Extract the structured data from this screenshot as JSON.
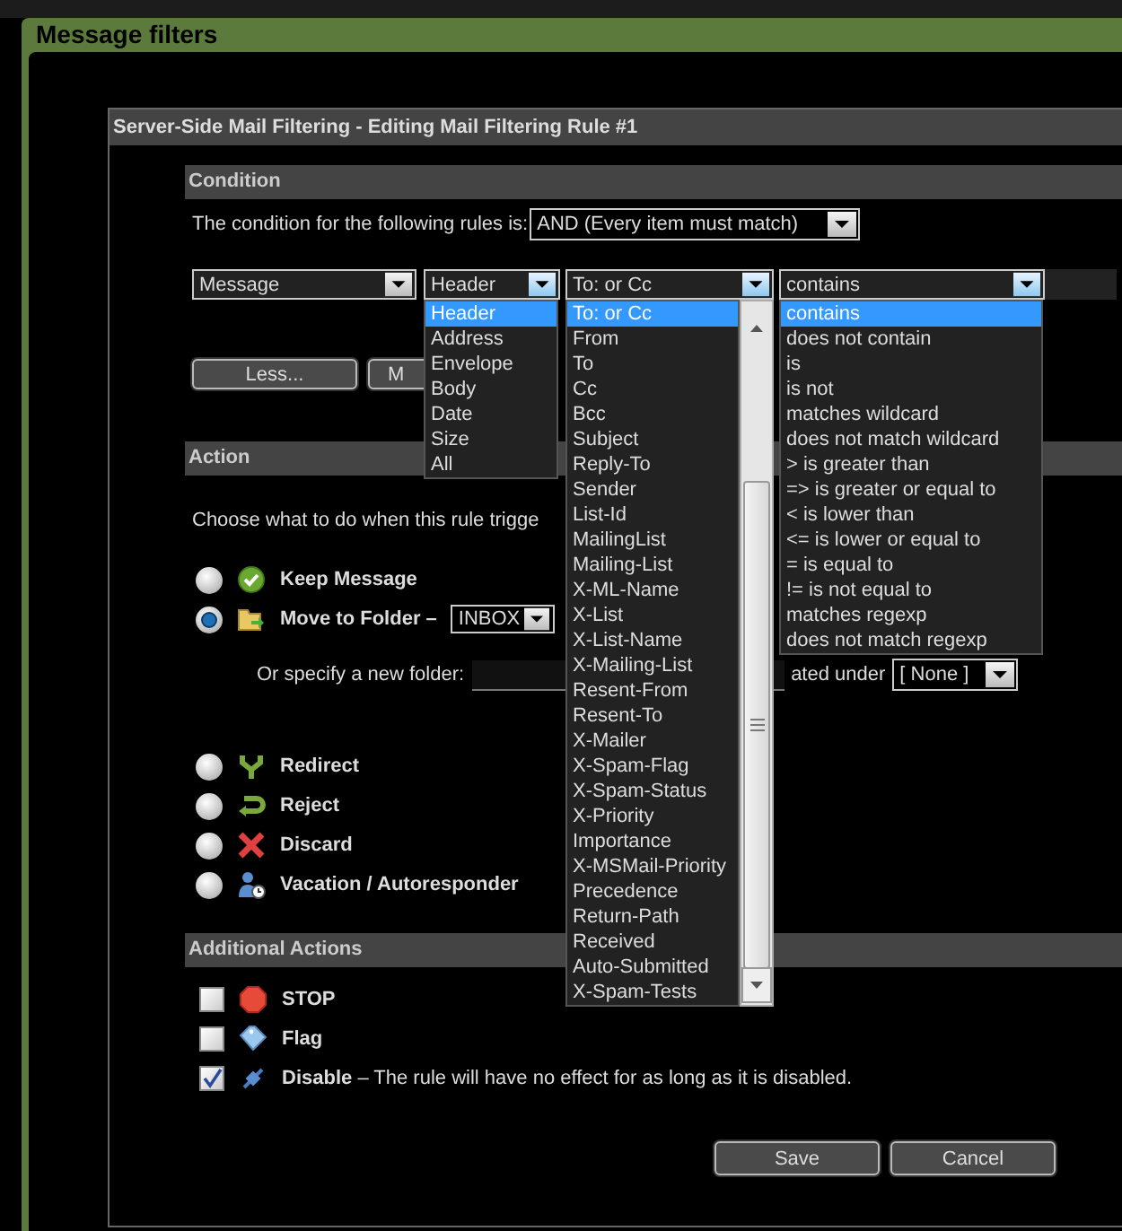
{
  "page": {
    "title": "Message filters"
  },
  "dialog": {
    "title": "Server-Side Mail Filtering - Editing Mail Filtering Rule #1"
  },
  "condition": {
    "heading": "Condition",
    "intro": "The condition for the following rules is:",
    "match": {
      "value": "AND (Every item must match)",
      "expanded": false
    },
    "criteria": [
      {
        "value": "Message",
        "expanded": false
      },
      {
        "value": "Header",
        "expanded": true,
        "options": [
          {
            "label": "Header",
            "selected": true
          },
          {
            "label": "Address",
            "selected": false
          },
          {
            "label": "Envelope",
            "selected": false
          },
          {
            "label": "Body",
            "selected": false
          },
          {
            "label": "Date",
            "selected": false
          },
          {
            "label": "Size",
            "selected": false
          },
          {
            "label": "All",
            "selected": false
          }
        ]
      },
      {
        "value": "To: or Cc",
        "expanded": true,
        "options": [
          {
            "label": "To: or Cc",
            "selected": true
          },
          {
            "label": "From",
            "selected": false
          },
          {
            "label": "To",
            "selected": false
          },
          {
            "label": "Cc",
            "selected": false
          },
          {
            "label": "Bcc",
            "selected": false
          },
          {
            "label": "Subject",
            "selected": false
          },
          {
            "label": "Reply-To",
            "selected": false
          },
          {
            "label": "Sender",
            "selected": false
          },
          {
            "label": "List-Id",
            "selected": false
          },
          {
            "label": "MailingList",
            "selected": false
          },
          {
            "label": "Mailing-List",
            "selected": false
          },
          {
            "label": "X-ML-Name",
            "selected": false
          },
          {
            "label": "X-List",
            "selected": false
          },
          {
            "label": "X-List-Name",
            "selected": false
          },
          {
            "label": "X-Mailing-List",
            "selected": false
          },
          {
            "label": "Resent-From",
            "selected": false
          },
          {
            "label": "Resent-To",
            "selected": false
          },
          {
            "label": "X-Mailer",
            "selected": false
          },
          {
            "label": "X-Spam-Flag",
            "selected": false
          },
          {
            "label": "X-Spam-Status",
            "selected": false
          },
          {
            "label": "X-Priority",
            "selected": false
          },
          {
            "label": "Importance",
            "selected": false
          },
          {
            "label": "X-MSMail-Priority",
            "selected": false
          },
          {
            "label": "Precedence",
            "selected": false
          },
          {
            "label": "Return-Path",
            "selected": false
          },
          {
            "label": "Received",
            "selected": false
          },
          {
            "label": "Auto-Submitted",
            "selected": false
          },
          {
            "label": "X-Spam-Tests",
            "selected": false
          }
        ]
      },
      {
        "value": "contains",
        "expanded": true,
        "options": [
          {
            "label": "contains",
            "selected": true
          },
          {
            "label": "does not contain",
            "selected": false
          },
          {
            "label": "is",
            "selected": false
          },
          {
            "label": "is not",
            "selected": false
          },
          {
            "label": "matches wildcard",
            "selected": false
          },
          {
            "label": "does not match wildcard",
            "selected": false
          },
          {
            "label": "> is greater than",
            "selected": false
          },
          {
            "label": "=> is greater or equal to",
            "selected": false
          },
          {
            "label": "< is lower than",
            "selected": false
          },
          {
            "label": "<= is lower or equal to",
            "selected": false
          },
          {
            "label": "= is equal to",
            "selected": false
          },
          {
            "label": "!= is not equal to",
            "selected": false
          },
          {
            "label": "matches regexp",
            "selected": false
          },
          {
            "label": "does not match regexp",
            "selected": false
          }
        ]
      }
    ],
    "buttons": [
      "Less...",
      "M"
    ]
  },
  "action": {
    "heading": "Action",
    "intro": "Choose what to do when this rule trigge",
    "options": [
      {
        "kind": "keep",
        "label": "Keep Message",
        "selected": false
      },
      {
        "kind": "move",
        "label": "Move to Folder –",
        "selected": true
      },
      {
        "kind": "redirect",
        "label": "Redirect",
        "selected": false
      },
      {
        "kind": "reject",
        "label": "Reject",
        "selected": false
      },
      {
        "kind": "discard",
        "label": "Discard",
        "selected": false
      },
      {
        "kind": "vacation",
        "label": "Vacation / Autoresponder",
        "selected": false
      }
    ],
    "folder": {
      "value": "INBOX",
      "expanded": false
    },
    "new_folder": {
      "label": "Or specify a new folder:",
      "parent_label": "ated under",
      "parent": {
        "value": "[ None ]",
        "expanded": false
      }
    }
  },
  "additional": {
    "heading": "Additional Actions",
    "items": [
      {
        "kind": "stop",
        "label": "STOP",
        "checked": false
      },
      {
        "kind": "flag",
        "label": "Flag",
        "checked": false
      },
      {
        "kind": "disable",
        "label": "Disable",
        "description": "– The rule will have no effect for as long as it is disabled.",
        "checked": true
      }
    ]
  },
  "footer_buttons": [
    "Save",
    "Cancel"
  ]
}
